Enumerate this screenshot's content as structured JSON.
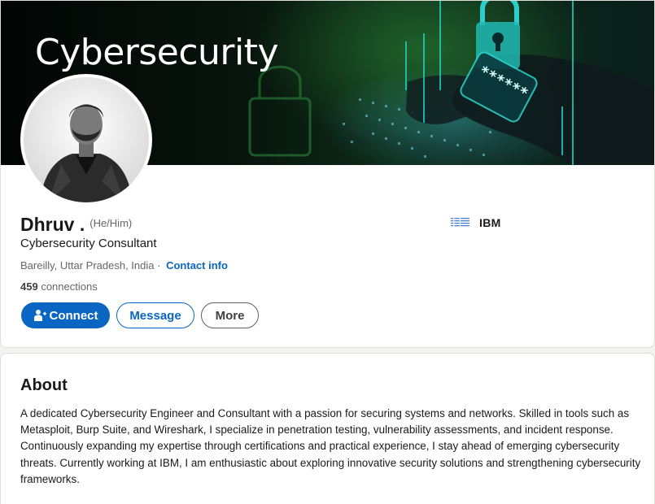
{
  "banner": {
    "title": "Cybersecurity",
    "password_mask": "******"
  },
  "profile": {
    "name": "Dhruv .",
    "pronouns": "(He/Him)",
    "headline": "Cybersecurity Consultant",
    "location": "Bareilly, Uttar Pradesh, India",
    "separator": "·",
    "contact_info_label": "Contact info",
    "connections_count": "459",
    "connections_label": "connections"
  },
  "company": {
    "name": "IBM",
    "logo_text": "IBM"
  },
  "actions": {
    "connect": "Connect",
    "message": "Message",
    "more": "More"
  },
  "about": {
    "title": "About",
    "text": "A dedicated Cybersecurity Engineer and Consultant with a passion for securing systems and networks. Skilled in tools such as Metasploit, Burp Suite, and Wireshark, I specialize in penetration testing, vulnerability assessments, and incident response. Continuously expanding my expertise through certifications and practical experience, I stay ahead of emerging cybersecurity threats. Currently working at IBM, I am enthusiastic about exploring innovative security solutions and strengthening cybersecurity frameworks."
  },
  "colors": {
    "accent": "#0a66c2",
    "banner_glow": "#22d3c5",
    "banner_green": "#2f8f3a"
  },
  "icons": {
    "connect": "add-person-icon",
    "lock": "padlock-icon"
  }
}
